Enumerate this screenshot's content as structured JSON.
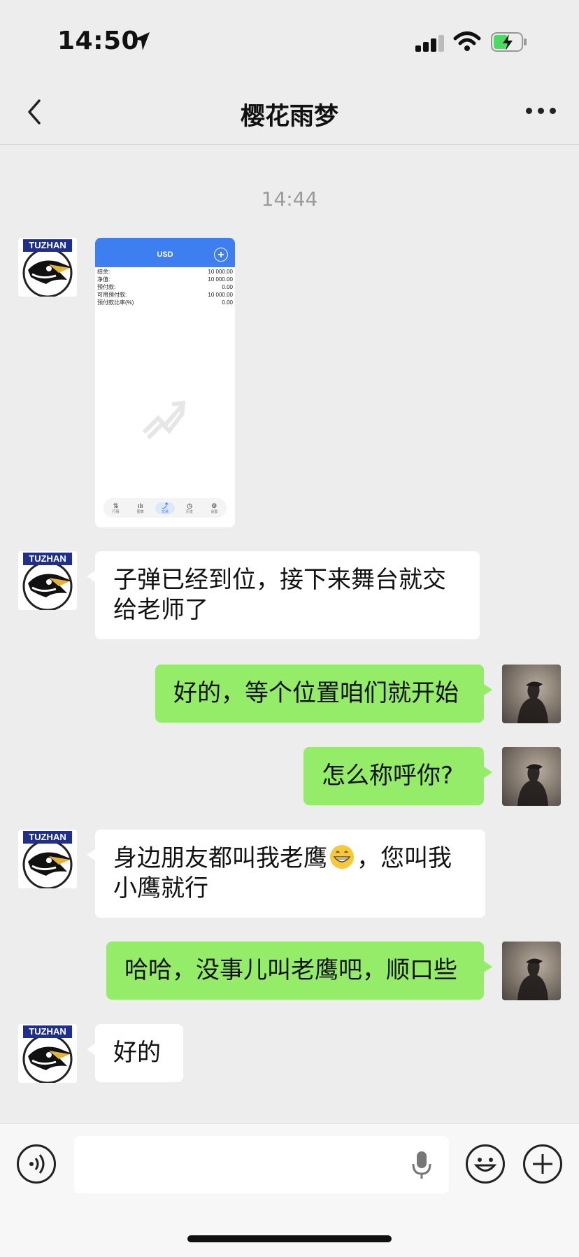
{
  "status_bar": {
    "time": "14:50"
  },
  "header": {
    "title": "樱花雨梦"
  },
  "timestamp": "14:44",
  "avatar_brand": "TUZHAN",
  "screenshot": {
    "currency": "USD",
    "rows": [
      {
        "label": "结余:",
        "value": "10 000.00"
      },
      {
        "label": "净值:",
        "value": "10 000.00"
      },
      {
        "label": "预付款:",
        "value": "0.00"
      },
      {
        "label": "可用预付款:",
        "value": "10 000.00"
      },
      {
        "label": "预付款比率(%)",
        "value": "0.00"
      }
    ],
    "tabs": [
      "行情",
      "图表",
      "交易",
      "历史",
      "设置"
    ]
  },
  "messages": [
    {
      "side": "in",
      "text": "子弹已经到位，接下来舞台就交给老师了"
    },
    {
      "side": "out",
      "text": "好的，等个位置咱们就开始"
    },
    {
      "side": "out",
      "text": "怎么称呼你?"
    },
    {
      "side": "in",
      "text_before": "身边朋友都叫我老鹰",
      "text_after": "，您叫我小鹰就行"
    },
    {
      "side": "out",
      "text": "哈哈，没事儿叫老鹰吧，顺口些"
    },
    {
      "side": "in",
      "text": "好的"
    }
  ],
  "icons": {
    "back": "chevron-left-icon",
    "more": "more-dots-icon",
    "voice": "voice-icon",
    "mic": "microphone-icon",
    "emoji": "emoji-icon",
    "plus": "plus-icon"
  },
  "colors": {
    "outgoing_bubble": "#95ec69",
    "incoming_bubble": "#ffffff",
    "background": "#ededed"
  }
}
